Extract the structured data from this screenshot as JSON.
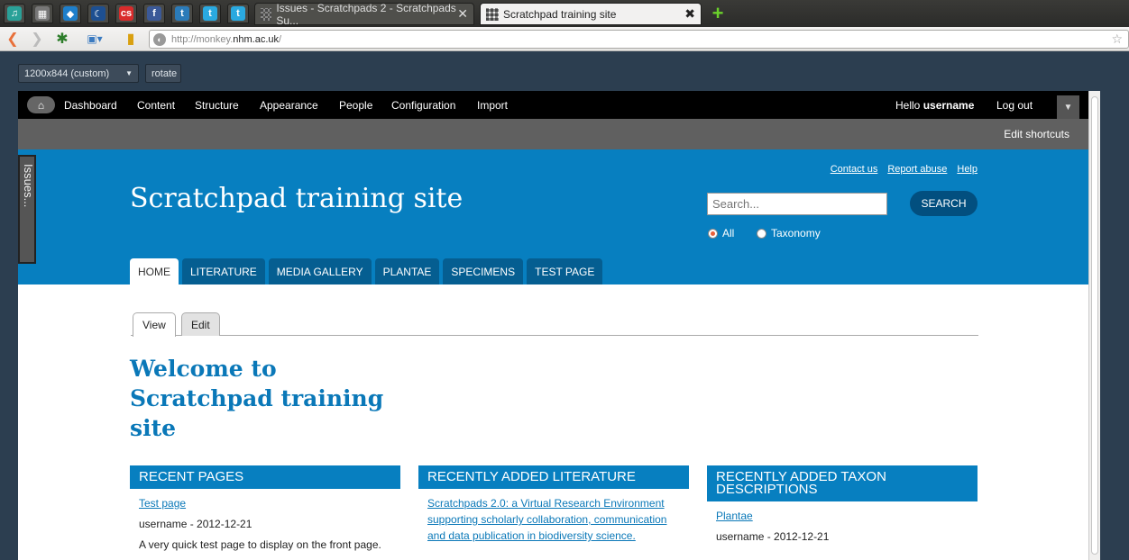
{
  "browser": {
    "app_tabs": [
      {
        "icon": "music-icon",
        "glyph": "♫",
        "color": "#2aa198"
      },
      {
        "icon": "grid-icon",
        "glyph": "▦",
        "color": "#777777"
      },
      {
        "icon": "drupal-icon",
        "glyph": "◆",
        "color": "#1e7fcb"
      },
      {
        "icon": "moon-icon",
        "glyph": "☾",
        "color": "#1d4f91"
      },
      {
        "icon": "cs-icon",
        "glyph": "cs",
        "color": "#d92b2b"
      },
      {
        "icon": "facebook-icon",
        "glyph": "f",
        "color": "#3b5998"
      },
      {
        "icon": "twitter-icon",
        "glyph": "t",
        "color": "#2b7bb9"
      },
      {
        "icon": "twitter-icon",
        "glyph": "t",
        "color": "#2aa9e0"
      },
      {
        "icon": "twitter-icon",
        "glyph": "t",
        "color": "#2aa9e0"
      }
    ],
    "tabs": [
      {
        "title": "Issues - Scratchpads 2 - Scratchpads Su...",
        "close": "✕",
        "active": false
      },
      {
        "title": "Scratchpad training site",
        "close": "✖",
        "active": true
      }
    ],
    "url_prefix": "http://monkey.",
    "url_host": "nhm.ac.uk",
    "url_suffix": "/",
    "responsive": {
      "size": "1200x844 (custom)",
      "rotate": "rotate"
    }
  },
  "admin": {
    "menu": [
      "Dashboard",
      "Content",
      "Structure",
      "Appearance",
      "People",
      "Configuration",
      "Import"
    ],
    "hello": "Hello",
    "username": "username",
    "logout": "Log out",
    "edit_shortcuts": "Edit shortcuts"
  },
  "issues_tab": "Issues...",
  "header": {
    "site_name": "Scratchpad training site",
    "links": [
      "Contact us",
      "Report abuse",
      "Help"
    ],
    "search_placeholder": "Search...",
    "search_button": "SEARCH",
    "radio_all": "All",
    "radio_taxonomy": "Taxonomy",
    "nav": [
      "HOME",
      "LITERATURE",
      "MEDIA GALLERY",
      "PLANTAE",
      "SPECIMENS",
      "TEST PAGE"
    ]
  },
  "local_tabs": {
    "view": "View",
    "edit": "Edit"
  },
  "page_title": "Welcome to Scratchpad training site",
  "blocks": {
    "recent_pages": {
      "title": "RECENT PAGES",
      "link": "Test page",
      "meta": "username - 2012-12-21",
      "desc": "A very quick test page to display on the front page."
    },
    "recent_literature": {
      "title": "RECENTLY ADDED LITERATURE",
      "link": "Scratchpads 2.0: a Virtual Research Environment supporting scholarly collaboration, communication and data publication in biodiversity science."
    },
    "recent_taxon": {
      "title": "RECENTLY ADDED TAXON DESCRIPTIONS",
      "link": "Plantae",
      "meta": "username - 2012-12-21"
    }
  }
}
